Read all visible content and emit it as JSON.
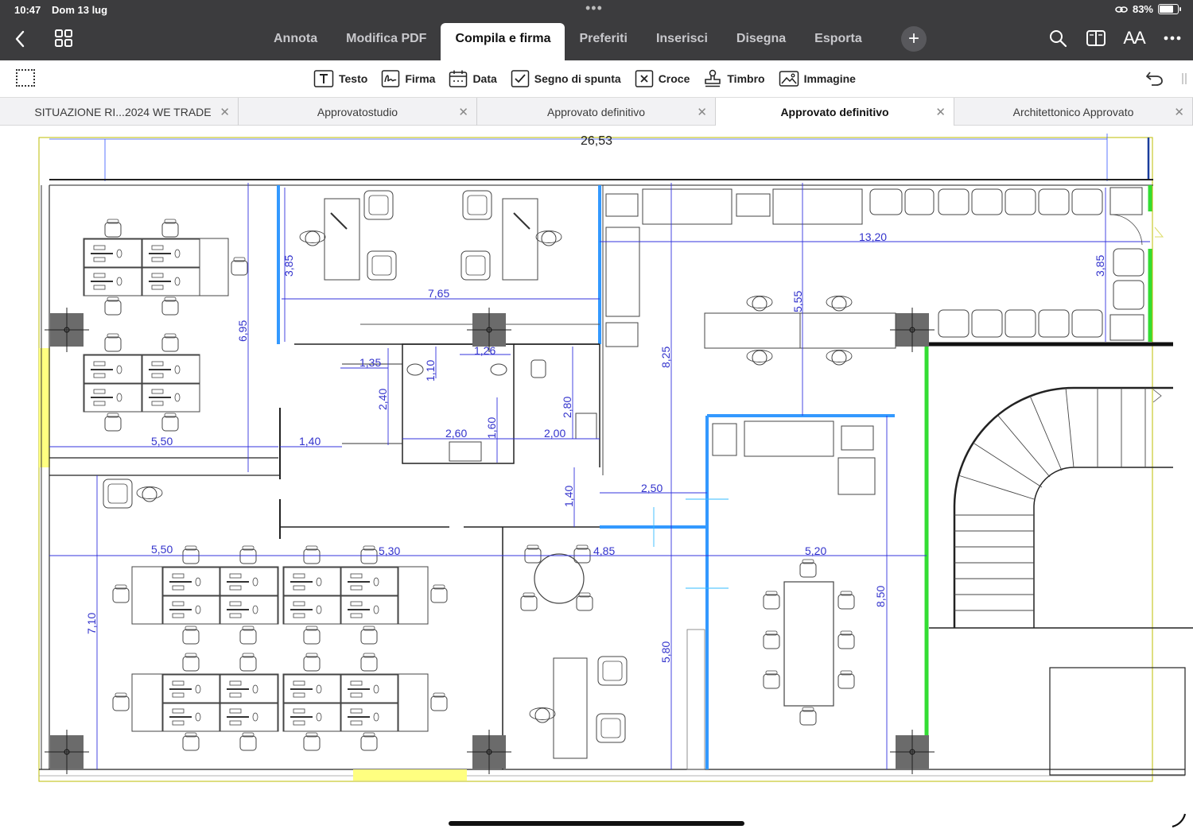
{
  "status": {
    "time": "10:47",
    "date": "Dom 13 lug",
    "dots": "•••",
    "battery_pct": "83%",
    "battery_level": 0.83
  },
  "nav": {
    "back_icon": "chevron-left-icon",
    "grid_icon": "grid-icon"
  },
  "tabs": [
    {
      "label": "Annota"
    },
    {
      "label": "Modifica PDF"
    },
    {
      "label": "Compila e firma",
      "active": true
    },
    {
      "label": "Preferiti"
    },
    {
      "label": "Inserisci"
    },
    {
      "label": "Disegna"
    },
    {
      "label": "Esporta"
    }
  ],
  "add_tab": "+",
  "right_icons": [
    "search-icon",
    "book-icon",
    "text-size-icon",
    "more-icon"
  ],
  "text_size_label": "AA",
  "toolbar": {
    "items": [
      {
        "label": "Testo",
        "icon": "text-icon"
      },
      {
        "label": "Firma",
        "icon": "signature-icon"
      },
      {
        "label": "Data",
        "icon": "calendar-icon"
      },
      {
        "label": "Segno di spunta",
        "icon": "checkmark-icon"
      },
      {
        "label": "Croce",
        "icon": "cross-icon"
      },
      {
        "label": "Timbro",
        "icon": "stamp-icon"
      },
      {
        "label": "Immagine",
        "icon": "image-icon"
      }
    ]
  },
  "document_tabs": [
    {
      "label": "SITUAZIONE RI...2024 WE TRADE"
    },
    {
      "label": "Approvatostudio"
    },
    {
      "label": "Approvato definitivo"
    },
    {
      "label": "Approvato definitivo",
      "active": true
    },
    {
      "label": "Architettonico Approvato"
    }
  ],
  "drawing": {
    "dimensions": [
      "26,53",
      "13,20",
      "3,85",
      "3,85",
      "7,65",
      "6,95",
      "5,55",
      "8,25",
      "1,35",
      "1,10",
      "1,26",
      "2,40",
      "2,80",
      "2,60",
      "2,00",
      "1,60",
      "5,50",
      "1,40",
      "2,50",
      "1,40",
      "5,50",
      "5,30",
      "4,85",
      "5,20",
      "8,50",
      "7,10",
      "5,80"
    ]
  }
}
